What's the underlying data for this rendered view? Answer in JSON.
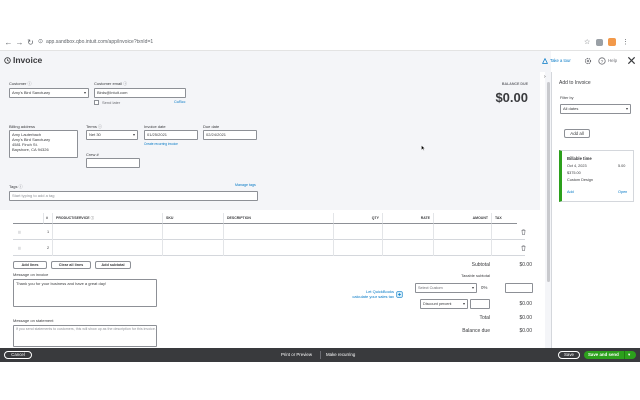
{
  "browser": {
    "url": "app.sandbox.qbo.intuit.com/app/invoice?txnId=1",
    "icons": [
      "back-icon",
      "forward-icon",
      "reload-icon",
      "star-icon",
      "extension-icon",
      "profile-icon",
      "menu-icon"
    ]
  },
  "header": {
    "title": "Invoice",
    "take_tour": "Take a tour",
    "help": "Help"
  },
  "customer": {
    "label": "Customer",
    "value": "Amy's Bird Sanctuary",
    "email_label": "Customer email",
    "email_value": "Birds@Intuit.com",
    "send_later": "Send later",
    "cc_bcc": "Cc/Bcc"
  },
  "balance": {
    "label": "BALANCE DUE",
    "value": "$0.00"
  },
  "billing": {
    "label": "Billing address",
    "lines": [
      "Amy Lauterbach",
      "Amy's Bird Sanctuary",
      "4581 Finch St.",
      "Bayshore, CA  94326"
    ]
  },
  "terms": {
    "label": "Terms",
    "value": "Net 30"
  },
  "invoice_date": {
    "label": "Invoice date",
    "value": "01/25/2021",
    "link": "Create recurring invoice"
  },
  "due_date": {
    "label": "Due date",
    "value": "02/24/2021"
  },
  "crew": {
    "label": "Crew #",
    "value": ""
  },
  "tags": {
    "label": "Tags",
    "manage": "Manage tags",
    "placeholder": "Start typing to add a tag"
  },
  "table": {
    "columns": [
      "#",
      "PRODUCT/SERVICE",
      "SKU",
      "DESCRIPTION",
      "QTY",
      "RATE",
      "AMOUNT",
      "TAX"
    ],
    "rows": [
      {
        "num": "1"
      },
      {
        "num": "2"
      }
    ]
  },
  "buttons": {
    "add_lines": "Add lines",
    "clear_all": "Clear all lines",
    "add_subtotal": "Add subtotal"
  },
  "message_invoice": {
    "label": "Message on invoice",
    "value": "Thank you for your business and have a great day!"
  },
  "message_statement": {
    "label": "Message on statement",
    "placeholder": "If you send statements to customers, this will show up as the description for this invoice."
  },
  "promo": {
    "line1": "Let QuickBooks",
    "line2": "calculate your sales tax"
  },
  "totals": {
    "subtotal_label": "Subtotal",
    "subtotal_value": "$0.00",
    "taxable_subtotal": "Taxable subtotal",
    "tax_select": "Select Custom",
    "tax_rate": "0%",
    "discount_select": "Discount percent",
    "discount_value": "$0.00",
    "total_label": "Total",
    "total_value": "$0.00",
    "balance_label": "Balance due",
    "balance_value": "$0.00"
  },
  "panel": {
    "title": "Add to Invoice",
    "filter_label": "Filter by",
    "filter_value": "All dates",
    "add_all": "Add all",
    "card": {
      "title": "Billable time",
      "date": "Oct 4, 2023",
      "amount": "$375.00",
      "hours": "5.00",
      "desc": "Custom Design",
      "add": "Add",
      "open": "Open"
    }
  },
  "footer": {
    "cancel": "Cancel",
    "print": "Print or Preview",
    "recurring": "Make recurring",
    "save": "Save",
    "save_send": "Save and send"
  },
  "colors": {
    "primary_green": "#2ca01c",
    "link_blue": "#0077c5",
    "footer": "#393a3d"
  }
}
